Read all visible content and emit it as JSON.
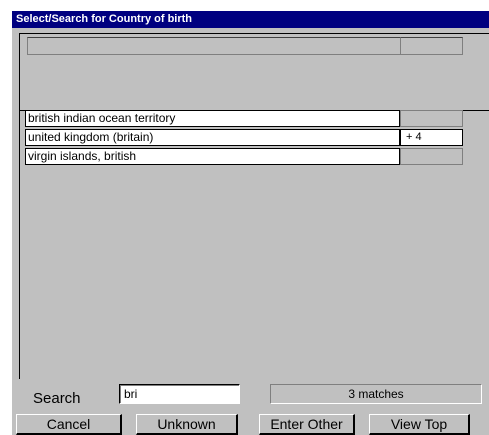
{
  "window": {
    "title": "Select/Search for Country of birth"
  },
  "list": {
    "rows": [
      {
        "label": "british indian ocean territory",
        "extra": ""
      },
      {
        "label": "united kingdom (britain)",
        "extra": "+ 4"
      },
      {
        "label": "virgin islands, british",
        "extra": ""
      }
    ]
  },
  "search": {
    "label": "Search",
    "value": "bri",
    "matches": "3 matches"
  },
  "buttons": {
    "cancel": "Cancel",
    "unknown": "Unknown",
    "enter_other": "Enter Other",
    "view_top": "View Top"
  }
}
